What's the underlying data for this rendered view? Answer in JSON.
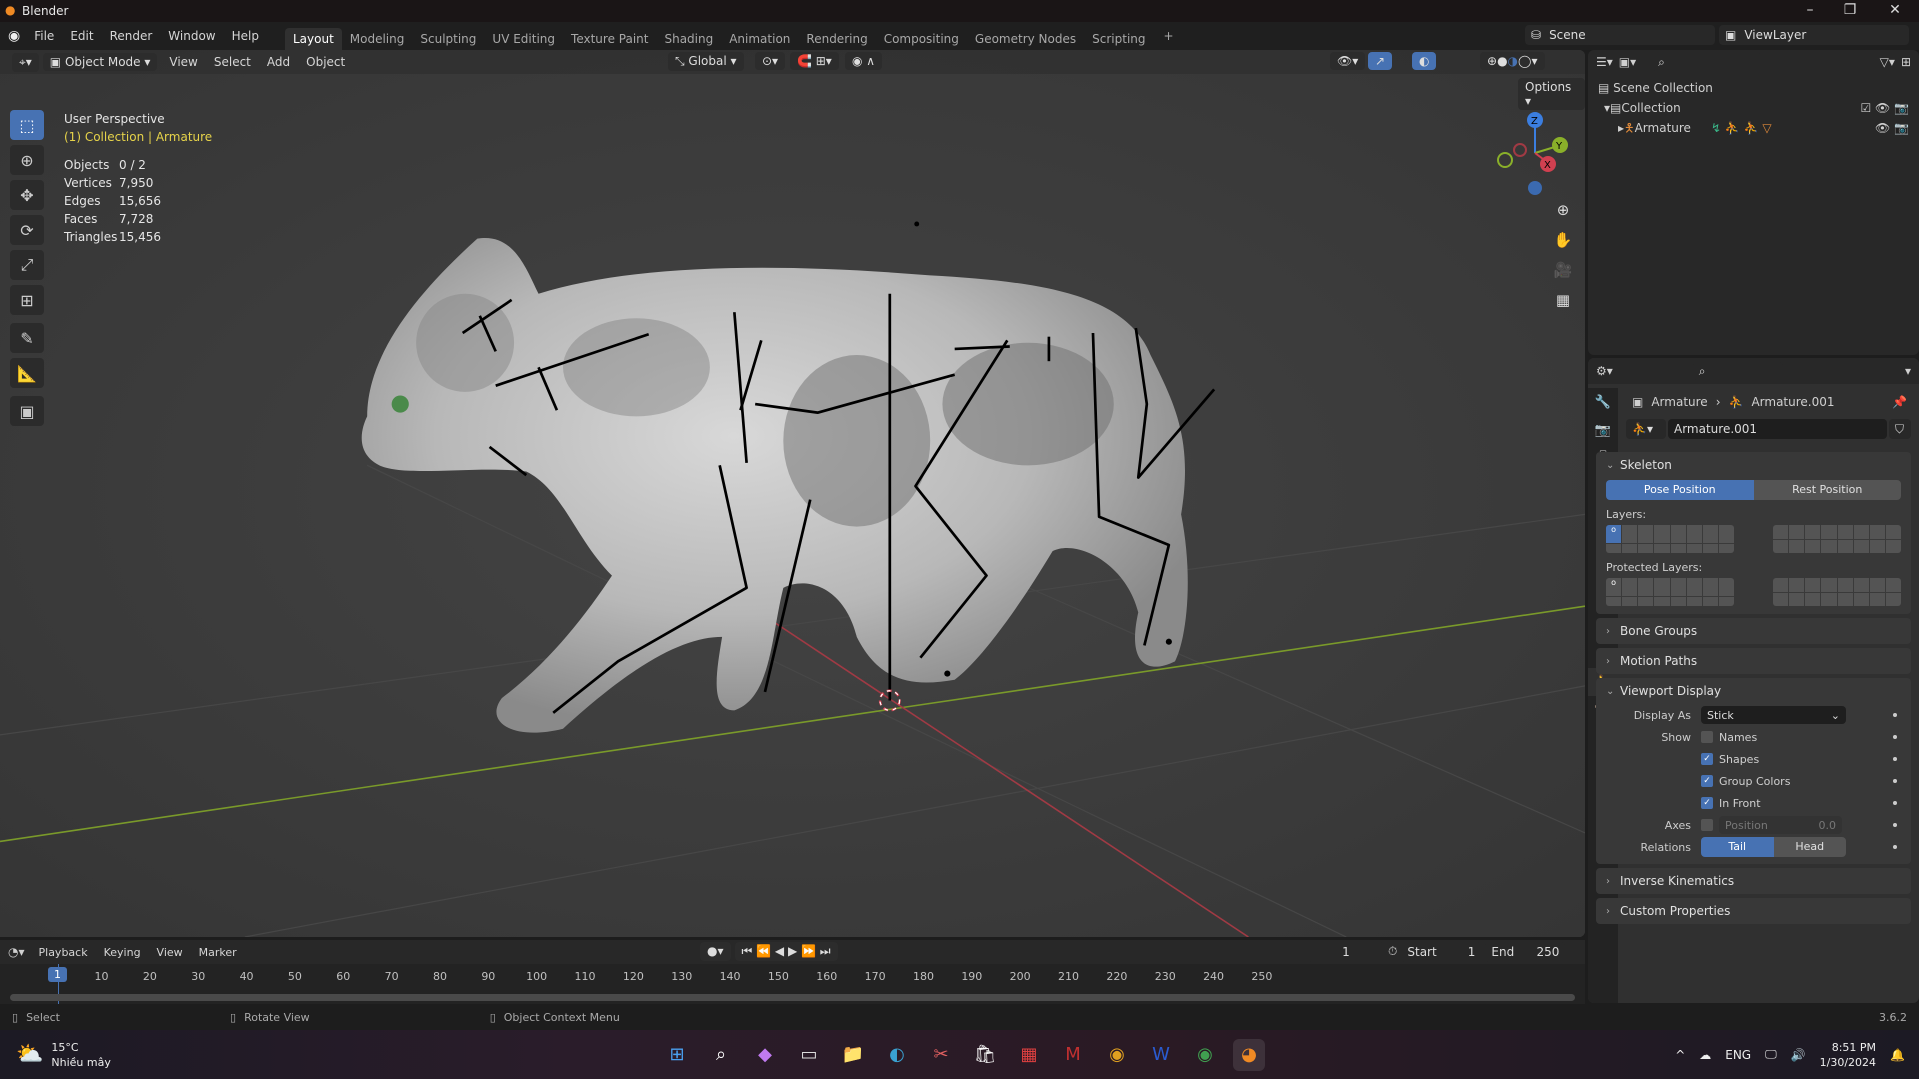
{
  "window": {
    "title": "Blender",
    "minimize": "–",
    "maximize": "❐",
    "close": "✕"
  },
  "menu": [
    "File",
    "Edit",
    "Render",
    "Window",
    "Help"
  ],
  "workspaces": [
    "Layout",
    "Modeling",
    "Sculpting",
    "UV Editing",
    "Texture Paint",
    "Shading",
    "Animation",
    "Rendering",
    "Compositing",
    "Geometry Nodes",
    "Scripting"
  ],
  "add_workspace": "+",
  "scene": {
    "name": "Scene",
    "view_layer": "ViewLayer"
  },
  "viewport": {
    "mode": "Object Mode",
    "menus": [
      "View",
      "Select",
      "Add",
      "Object"
    ],
    "orientation": "Global",
    "options": "Options",
    "perspective": "User Perspective",
    "context": "(1) Collection | Armature",
    "stats": [
      {
        "label": "Objects",
        "value": "0 / 2"
      },
      {
        "label": "Vertices",
        "value": "7,950"
      },
      {
        "label": "Edges",
        "value": "15,656"
      },
      {
        "label": "Faces",
        "value": "7,728"
      },
      {
        "label": "Triangles",
        "value": "15,456"
      }
    ],
    "gizmo": {
      "z": "Z",
      "y": "Y",
      "x": "X"
    }
  },
  "outliner": {
    "items": [
      {
        "label": "Scene Collection"
      },
      {
        "label": "Collection"
      },
      {
        "label": "Armature"
      }
    ]
  },
  "properties": {
    "breadcrumb": [
      "Armature",
      "Armature.001"
    ],
    "datablock": "Armature.001",
    "skeleton": {
      "title": "Skeleton",
      "pose": "Pose Position",
      "rest": "Rest Position",
      "layers": "Layers:",
      "protected": "Protected Layers:",
      "layer_mark": "o"
    },
    "collapsed": [
      "Bone Groups",
      "Motion Paths"
    ],
    "viewport_display": {
      "title": "Viewport Display",
      "display_as_label": "Display As",
      "display_as": "Stick",
      "show_label": "Show",
      "show": [
        {
          "label": "Names",
          "checked": false
        },
        {
          "label": "Shapes",
          "checked": true
        },
        {
          "label": "Group Colors",
          "checked": true
        },
        {
          "label": "In Front",
          "checked": true
        }
      ],
      "axes_label": "Axes",
      "position_label": "Position",
      "position_value": "0.0",
      "relations_label": "Relations",
      "tail": "Tail",
      "head": "Head"
    },
    "bottom_panels": [
      "Inverse Kinematics",
      "Custom Properties"
    ]
  },
  "timeline": {
    "menus": [
      "Playback",
      "Keying",
      "View",
      "Marker"
    ],
    "current_frame": "1",
    "start_label": "Start",
    "start": "1",
    "end_label": "End",
    "end": "250",
    "ticks": [
      "10",
      "20",
      "30",
      "40",
      "50",
      "60",
      "70",
      "80",
      "90",
      "100",
      "110",
      "120",
      "130",
      "140",
      "150",
      "160",
      "170",
      "180",
      "190",
      "200",
      "210",
      "220",
      "230",
      "240",
      "250"
    ],
    "playhead": "1"
  },
  "statusbar": {
    "select": "Select",
    "rotate": "Rotate View",
    "context": "Object Context Menu",
    "version": "3.6.2"
  },
  "taskbar": {
    "temp": "15°C",
    "weather": "Nhiều mây",
    "lang": "ENG",
    "time": "8:51 PM",
    "date": "1/30/2024",
    "apps": [
      "start-icon",
      "search-icon",
      "copilot-icon",
      "task-view-icon",
      "file-explorer-icon",
      "edge-icon",
      "snipping-tool-icon",
      "store-icon",
      "app-icon",
      "mcafee-icon",
      "chrome-icon",
      "word-icon",
      "chrome-profile-icon",
      "blender-icon"
    ]
  },
  "colors": {
    "accent": "#4772b3",
    "yellow": "#e6d34a",
    "x_axis": "#d04050",
    "y_axis": "#8ab02a",
    "z_axis": "#3b7ee0"
  }
}
